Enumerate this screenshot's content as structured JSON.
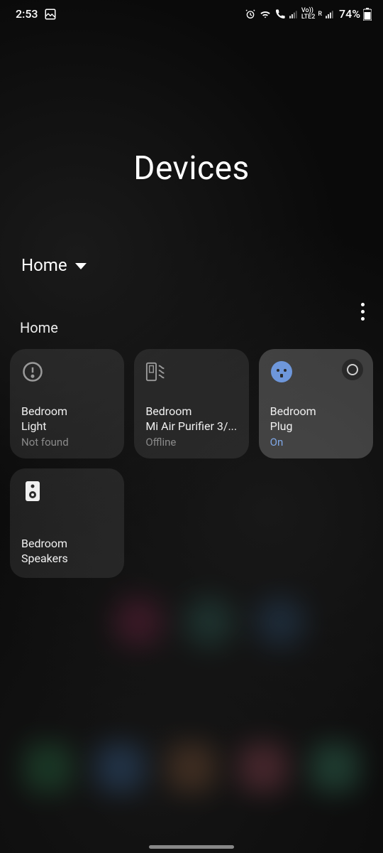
{
  "status": {
    "time": "2:53",
    "battery": "74%",
    "network_label": "LTE2",
    "voice_label": "Vo))",
    "roaming_label": "R"
  },
  "page": {
    "title": "Devices"
  },
  "location": {
    "selected": "Home"
  },
  "section": {
    "label": "Home"
  },
  "devices": [
    {
      "name_line1": "Bedroom",
      "name_line2": "Light",
      "status": "Not found",
      "icon": "alert",
      "active": false
    },
    {
      "name_line1": "Bedroom",
      "name_line2": "Mi Air Purifier 3/...",
      "status": "Offline",
      "icon": "purifier",
      "active": false
    },
    {
      "name_line1": "Bedroom",
      "name_line2": "Plug",
      "status": "On",
      "icon": "plug",
      "active": true
    },
    {
      "name_line1": "Bedroom",
      "name_line2": "Speakers",
      "status": "",
      "icon": "speaker",
      "active": false
    }
  ]
}
